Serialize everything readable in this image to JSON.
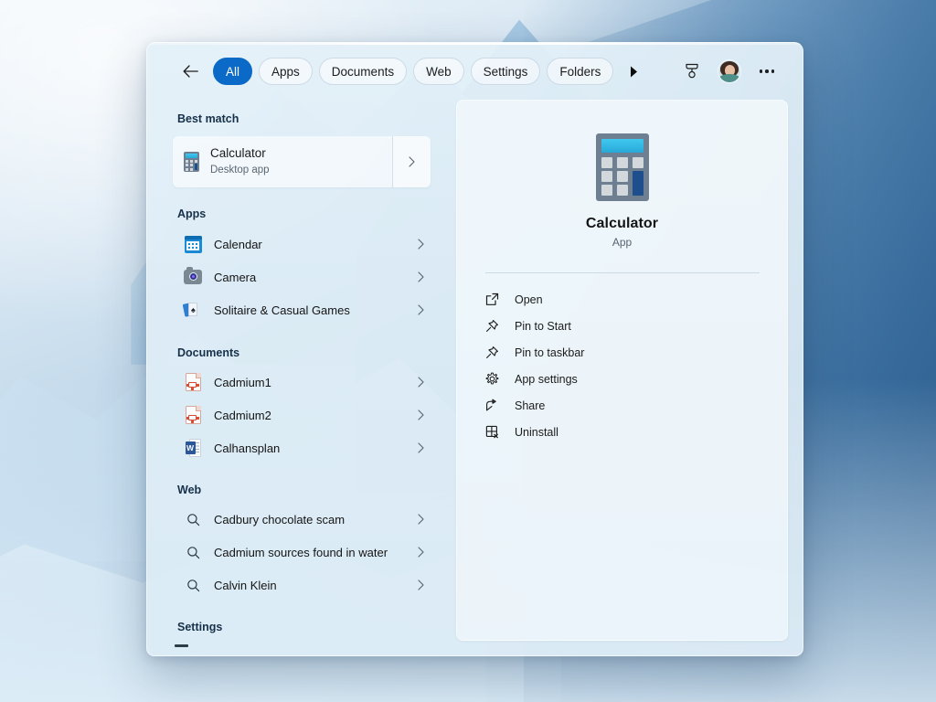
{
  "toolbar": {
    "back_label": "Back",
    "filters": [
      {
        "label": "All",
        "active": true
      },
      {
        "label": "Apps",
        "active": false
      },
      {
        "label": "Documents",
        "active": false
      },
      {
        "label": "Web",
        "active": false
      },
      {
        "label": "Settings",
        "active": false
      },
      {
        "label": "Folders",
        "active": false
      }
    ],
    "more_filters_icon": "triangle-right-icon",
    "rewards_icon": "rewards-medal-icon",
    "avatar_label": "Account",
    "overflow_icon": "ellipsis-icon"
  },
  "results": {
    "best_match": {
      "heading": "Best match",
      "title": "Calculator",
      "subtitle": "Desktop app",
      "icon": "calculator-icon"
    },
    "apps": {
      "heading": "Apps",
      "items": [
        {
          "label": "Calendar",
          "icon": "calendar-icon"
        },
        {
          "label": "Camera",
          "icon": "camera-icon"
        },
        {
          "label": "Solitaire & Casual Games",
          "icon": "solitaire-icon"
        }
      ]
    },
    "documents": {
      "heading": "Documents",
      "items": [
        {
          "label": "Cadmium1",
          "icon": "document-icon"
        },
        {
          "label": "Cadmium2",
          "icon": "document-icon"
        },
        {
          "label": "Calhansplan",
          "icon": "word-document-icon"
        }
      ]
    },
    "web": {
      "heading": "Web",
      "items": [
        {
          "label": "Cadbury chocolate scam",
          "icon": "search-icon"
        },
        {
          "label": "Cadmium sources found in water",
          "icon": "search-icon"
        },
        {
          "label": "Calvin Klein",
          "icon": "search-icon"
        }
      ]
    },
    "settings": {
      "heading": "Settings"
    }
  },
  "preview": {
    "app_name": "Calculator",
    "app_type": "App",
    "icon": "calculator-icon",
    "actions": [
      {
        "label": "Open",
        "icon": "open-external-icon"
      },
      {
        "label": "Pin to Start",
        "icon": "pin-icon"
      },
      {
        "label": "Pin to taskbar",
        "icon": "pin-icon"
      },
      {
        "label": "App settings",
        "icon": "gear-icon"
      },
      {
        "label": "Share",
        "icon": "share-icon"
      },
      {
        "label": "Uninstall",
        "icon": "uninstall-icon"
      }
    ]
  },
  "colors": {
    "accent": "#0b69c7",
    "window_tint": "#dfedf6",
    "preview_bg": "#eff6fb",
    "text_primary": "#141414",
    "text_secondary": "#5c6772"
  }
}
